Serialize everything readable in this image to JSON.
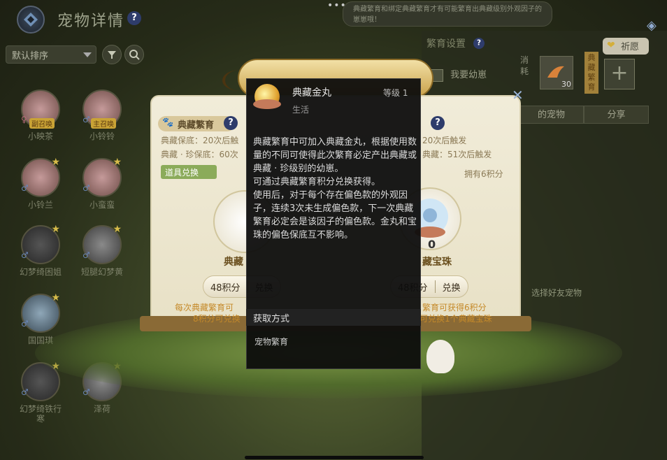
{
  "header": {
    "title": "宠物详情",
    "sort_value": "默认排序"
  },
  "notice": {
    "text": "典藏繁育和绑定典藏繁育才有可能繁育出典藏级别外观因子的崽崽哦！"
  },
  "pets": [
    {
      "name": "小映茶",
      "sex": "♀",
      "tag": "副召唤",
      "style": "pink"
    },
    {
      "name": "小铃铃",
      "sex": "♂",
      "tag": "主召唤",
      "style": "pink"
    },
    {
      "name": "小铃兰",
      "sex": "♂",
      "style": "pink"
    },
    {
      "name": "小蛮蛮",
      "sex": "♂",
      "style": "pink"
    },
    {
      "name": "幻梦绮困姐",
      "sex": "♂",
      "style": "dark"
    },
    {
      "name": "短腿幻梦黄",
      "sex": "♂",
      "style": "grey"
    },
    {
      "name": "国国琪",
      "sex": "♂",
      "style": "blue"
    },
    {
      "name": "幻梦绮铁行寒",
      "sex": "♂",
      "style": "dark"
    },
    {
      "name": "泽荷",
      "sex": "♂",
      "style": "grey"
    }
  ],
  "right_panel": {
    "title": "繁育设置",
    "pray_label": "祈愿",
    "want_label": "我要幼崽",
    "slot_label": "消耗",
    "slot_count": "30",
    "slot_side": "典藏繁育",
    "tabs": [
      "的宠物",
      "分享"
    ],
    "side_text": "选择好友宠物"
  },
  "exchange": {
    "section_title": "典藏繁育",
    "left_rule1": "典藏保底：20次后触",
    "left_rule2": "典藏 · 珍保底：60次",
    "right_rule1": "20次后触发",
    "right_rule2": "典藏：51次后触发",
    "item_section": "道具兑换",
    "own_points": "拥有6积分",
    "left_item_name": "典藏",
    "right_item_name": "藏宝珠",
    "right_item_count": "0",
    "left_btn_points": "48积分",
    "left_btn_action": "兑换",
    "right_btn_points": "48积分",
    "right_btn_action": "兑换",
    "left_note1": "每次典藏繁育可",
    "left_note2": "8积分可兑换",
    "right_note1": "繁育可获得6积分",
    "right_note2": "可兑换1个典藏宝珠"
  },
  "tooltip": {
    "title": "典藏金丸",
    "level": "等级 1",
    "category": "生活",
    "desc1": "典藏繁育中可加入典藏金丸，根据使用数量的不同可使得此次繁育必定产出典藏或典藏 · 珍级别的幼崽。",
    "desc2": "可通过典藏繁育积分兑换获得。",
    "desc3": "使用后，对于每个存在偏色款的外观因子，连续3次未生成偏色款，下一次典藏繁育必定会是该因子的偏色款。金丸和宝珠的偏色保底互不影响。",
    "source_head": "获取方式",
    "source": "宠物繁育"
  },
  "colors": {
    "accent_gold": "#c9a335",
    "tooltip_bg": "#0c0c0c",
    "board_bg": "#f1ecd9"
  }
}
